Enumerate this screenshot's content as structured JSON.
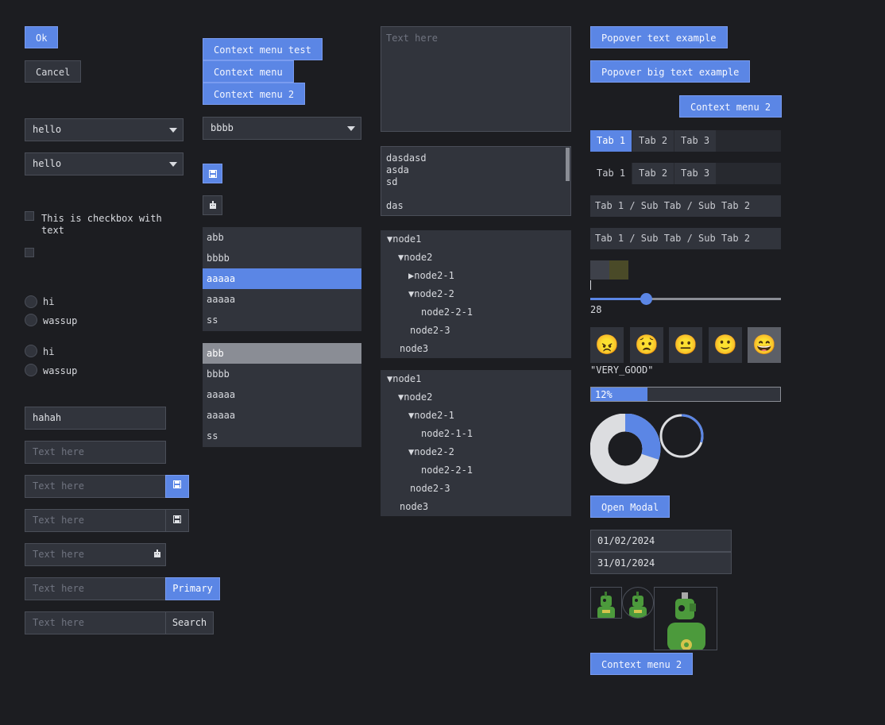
{
  "col1": {
    "ok": "Ok",
    "cancel": "Cancel",
    "select1": "hello",
    "select2": "hello",
    "checkbox1": "This is checkbox with text",
    "radio_group1": [
      "hi",
      "wassup"
    ],
    "radio_group2": [
      "hi",
      "wassup"
    ],
    "input_value": "hahah",
    "placeholder": "Text here",
    "primary_addon": "Primary",
    "search_addon": "Search"
  },
  "col2": {
    "ctx_test": "Context menu test",
    "ctx": "Context menu",
    "ctx2": "Context menu 2",
    "select": "bbbb",
    "list1": [
      "abb",
      "bbbb",
      "aaaaa",
      "aaaaa",
      "ss"
    ],
    "list2": [
      "abb",
      "bbbb",
      "aaaaa",
      "aaaaa",
      "ss"
    ]
  },
  "col3": {
    "textarea_placeholder": "Text here",
    "log_lines": [
      "dasdasd",
      "asda",
      "sd",
      "",
      "das"
    ],
    "tree1": [
      {
        "label": "▼node1"
      },
      {
        "label": "▼node2"
      },
      {
        "label": "▶node2-1"
      },
      {
        "label": "▼node2-2"
      },
      {
        "label": "node2-2-1"
      },
      {
        "label": "node2-3"
      },
      {
        "label": "node3"
      }
    ],
    "tree2": [
      {
        "label": "▼node1"
      },
      {
        "label": "▼node2"
      },
      {
        "label": "▼node2-1"
      },
      {
        "label": "node2-1-1"
      },
      {
        "label": "▼node2-2"
      },
      {
        "label": "node2-2-1"
      },
      {
        "label": "node2-3"
      },
      {
        "label": "node3"
      }
    ]
  },
  "col4": {
    "popover": "Popover text example",
    "popover_big": "Popover big text example",
    "ctx2_top": "Context menu 2",
    "tabs1": [
      "Tab 1",
      "Tab 2",
      "Tab 3"
    ],
    "tabs2": [
      "Tab 1",
      "Tab 2",
      "Tab 3"
    ],
    "breadcrumb1": "Tab 1 / Sub Tab / Sub Tab 2",
    "breadcrumb2": "Tab 1 / Sub Tab / Sub Tab 2",
    "slider_value": "28",
    "slider_fraction": 0.29,
    "emojis": [
      "😠",
      "😟",
      "😐",
      "🙂",
      "😄"
    ],
    "emoji_selected": "\"VERY_GOOD\"",
    "progress_label": "12%",
    "progress_fraction": 0.3,
    "pie_fraction": 0.3,
    "ring_fraction": 0.3,
    "open_modal": "Open Modal",
    "date1": "01/02/2024",
    "date2": "31/01/2024",
    "ctx2_bottom": "Context menu 2"
  },
  "colors": {
    "accent": "#5b86e5",
    "background": "#1c1d21",
    "widget": "#31343c"
  }
}
